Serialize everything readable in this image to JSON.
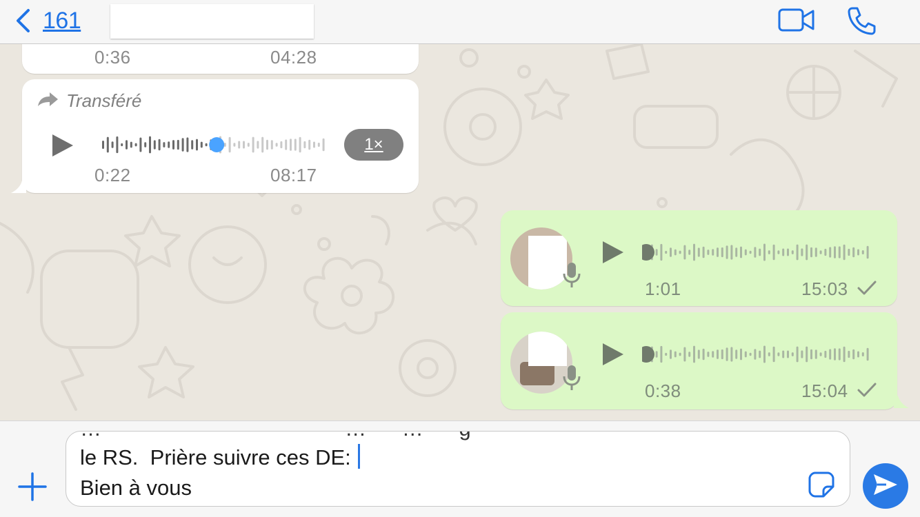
{
  "header": {
    "back_count": "161",
    "contact_name": "",
    "icons": {
      "back": "chevron-left-icon",
      "video": "video-camera-icon",
      "call": "phone-icon"
    },
    "accent_color": "#1f73e6"
  },
  "messages": [
    {
      "direction": "incoming",
      "voice": true,
      "duration": "0:36",
      "time": "04:28"
    },
    {
      "direction": "incoming",
      "voice": true,
      "forwarded_label": "Transféré",
      "duration": "0:22",
      "time": "08:17",
      "speed": "1×",
      "progress": 0.52,
      "progress_color": "#4aa3ff"
    },
    {
      "direction": "outgoing",
      "voice": true,
      "duration": "1:01",
      "time": "15:03",
      "status": "sent",
      "progress": 0
    },
    {
      "direction": "outgoing",
      "voice": true,
      "duration": "0:38",
      "time": "15:04",
      "status": "sent",
      "progress": 0
    }
  ],
  "composer": {
    "line_partial": "…                                         …      …      g",
    "line1": "le RS.  Prière suivre ces DE:",
    "line2": "Bien à vous"
  },
  "colors": {
    "incoming_bubble": "#ffffff",
    "outgoing_bubble": "#dcf8c6",
    "send_button": "#2a7ae5"
  }
}
